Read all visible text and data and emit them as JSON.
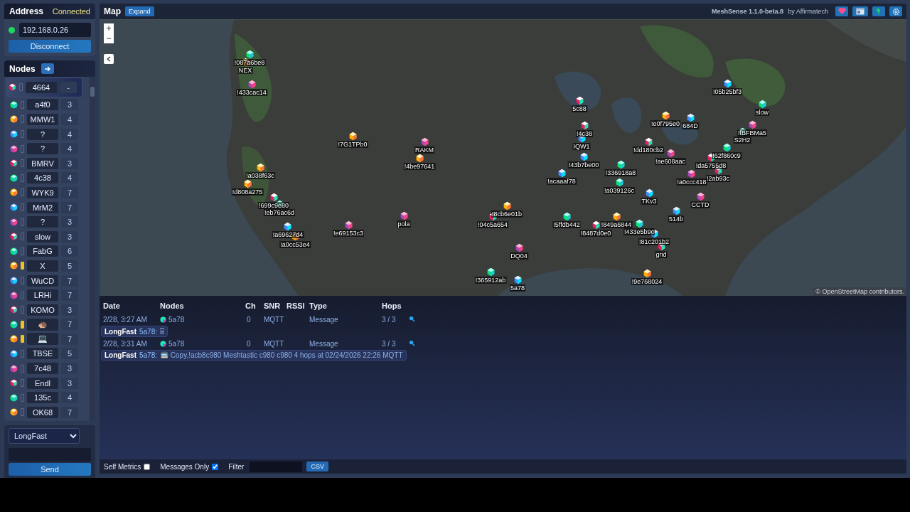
{
  "address_panel": {
    "title": "Address",
    "status": "Connected",
    "connected": true,
    "address": "192.168.0.26",
    "button": "Disconnect"
  },
  "nodes_panel": {
    "title": "Nodes",
    "nodes": [
      {
        "name": "4664",
        "hops": "-",
        "selected": true,
        "battery_low": false
      },
      {
        "name": "a4f0",
        "hops": "3",
        "selected": false,
        "battery_low": false
      },
      {
        "name": "MMW1",
        "hops": "4",
        "selected": false,
        "battery_low": false
      },
      {
        "name": "?",
        "hops": "4",
        "selected": false,
        "battery_low": false
      },
      {
        "name": "?",
        "hops": "4",
        "selected": false,
        "battery_low": false
      },
      {
        "name": "BMRV",
        "hops": "3",
        "selected": false,
        "battery_low": false
      },
      {
        "name": "4c38",
        "hops": "4",
        "selected": false,
        "battery_low": false
      },
      {
        "name": "WYK9",
        "hops": "7",
        "selected": false,
        "battery_low": false
      },
      {
        "name": "MrM2",
        "hops": "7",
        "selected": false,
        "battery_low": false
      },
      {
        "name": "?",
        "hops": "3",
        "selected": false,
        "battery_low": false
      },
      {
        "name": "slow",
        "hops": "3",
        "selected": false,
        "battery_low": false
      },
      {
        "name": "FabG",
        "hops": "6",
        "selected": false,
        "battery_low": false
      },
      {
        "name": "X",
        "hops": "5",
        "selected": false,
        "battery_low": true
      },
      {
        "name": "WuCD",
        "hops": "7",
        "selected": false,
        "battery_low": false
      },
      {
        "name": "LRHi",
        "hops": "7",
        "selected": false,
        "battery_low": false
      },
      {
        "name": "KOMO",
        "hops": "3",
        "selected": false,
        "battery_low": false
      },
      {
        "name": "🦔",
        "hops": "7",
        "selected": false,
        "battery_low": true
      },
      {
        "name": "💻",
        "hops": "7",
        "selected": false,
        "battery_low": true
      },
      {
        "name": "TBSE",
        "hops": "5",
        "selected": false,
        "battery_low": false
      },
      {
        "name": "7c48",
        "hops": "3",
        "selected": false,
        "battery_low": false
      },
      {
        "name": "Endl",
        "hops": "3",
        "selected": false,
        "battery_low": false
      },
      {
        "name": "135c",
        "hops": "4",
        "selected": false,
        "battery_low": false
      },
      {
        "name": "OK68",
        "hops": "7",
        "selected": false,
        "battery_low": false
      }
    ]
  },
  "send_panel": {
    "channel": "LongFast",
    "button": "Send"
  },
  "map": {
    "title": "Map",
    "expand": "Expand",
    "zoom_in": "+",
    "zoom_out": "−",
    "attribution": "© OpenStreetMap contributors.",
    "markers": [
      {
        "label": "!087a6be8"
      },
      {
        "label": "NEX"
      },
      {
        "label": "!05b25bf3"
      },
      {
        "label": "!433cac14"
      },
      {
        "label": "5c88"
      },
      {
        "label": "slow"
      },
      {
        "label": "!e0f795e0"
      },
      {
        "label": "684D"
      },
      {
        "label": "!fBFBMa5"
      },
      {
        "label": "!4c38"
      },
      {
        "label": "S2H2"
      },
      {
        "label": "!7G1TPb0"
      },
      {
        "label": "IQW1"
      },
      {
        "label": "RAKM"
      },
      {
        "label": "!dd180cb2"
      },
      {
        "label": "!62f860c9"
      },
      {
        "label": "!4be97641"
      },
      {
        "label": "!43b7be00"
      },
      {
        "label": "!ae608aac"
      },
      {
        "label": "!da5755d8"
      },
      {
        "label": "!336918a8"
      },
      {
        "label": "!a038f63c"
      },
      {
        "label": "!acaaaf78"
      },
      {
        "label": "!a0ccc418"
      },
      {
        "label": "!2ab93c"
      },
      {
        "label": "!a039126c"
      },
      {
        "label": "!d808a275"
      },
      {
        "label": "TKv3"
      },
      {
        "label": "CCTD"
      },
      {
        "label": "!699c9e80"
      },
      {
        "label": "!eb76ac6d"
      },
      {
        "label": "!8cb6e01b"
      },
      {
        "label": "514b"
      },
      {
        "label": "pola"
      },
      {
        "label": "!04c5a654"
      },
      {
        "label": "!5ffdb442"
      },
      {
        "label": "!849a6844"
      },
      {
        "label": "!a69627d4"
      },
      {
        "label": "!e69153c3"
      },
      {
        "label": "!8487d0e0"
      },
      {
        "label": "!433e5b9c"
      },
      {
        "label": "!a0cc53e4"
      },
      {
        "label": "!81c201b2"
      },
      {
        "label": "DQ04"
      },
      {
        "label": "grid"
      },
      {
        "label": "!365912ab"
      },
      {
        "label": "!9e768024"
      },
      {
        "label": "5a78"
      }
    ]
  },
  "header": {
    "app": "MeshSense 1.1.0-beta.8",
    "by": "by Affirmatech"
  },
  "log": {
    "columns": [
      "Date",
      "Nodes",
      "Ch",
      "SNR",
      "RSSI",
      "Type",
      "Hops"
    ],
    "entries": [
      {
        "date": "2/28, 3:27 AM",
        "node": "5a78",
        "ch": "0",
        "snr": "MQTT",
        "type": "Message",
        "hops": "3 / 3",
        "channel": "LongFast",
        "from": "5a78:",
        "text": "⌸"
      },
      {
        "date": "2/28, 3:31 AM",
        "node": "5a78",
        "ch": "0",
        "snr": "MQTT",
        "type": "Message",
        "hops": "3 / 3",
        "channel": "LongFast",
        "from": "5a78:",
        "text": "🚍 Copy,!acb8c980 Meshtastic c980 c980 4 hops at 02/24/2026 22:26 MQTT"
      }
    ]
  },
  "footer": {
    "self_metrics": {
      "label": "Self Metrics",
      "checked": false
    },
    "messages_only": {
      "label": "Messages Only",
      "checked": true
    },
    "filter": "Filter",
    "csv": "CSV"
  }
}
